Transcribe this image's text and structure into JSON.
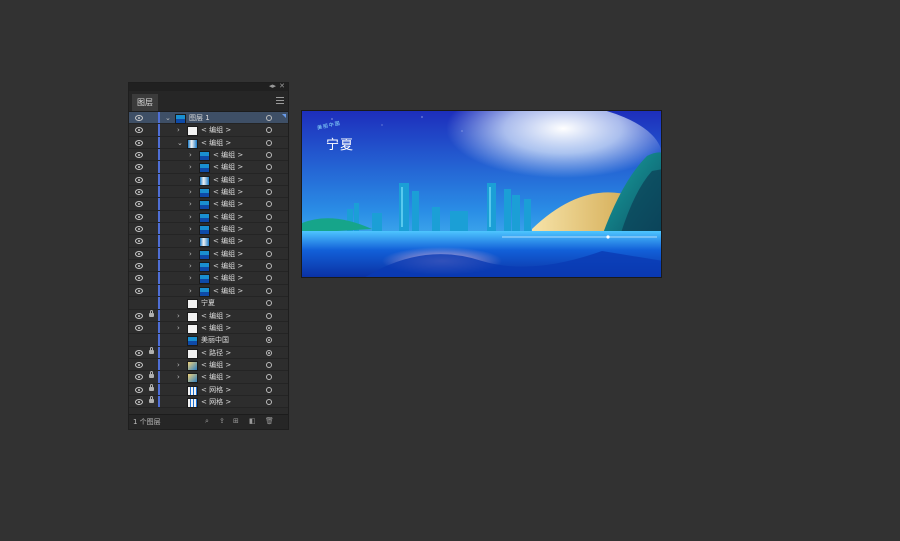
{
  "layers_panel": {
    "tab_label": "图层",
    "collapse_glyph": "◂▸",
    "close_glyph": "✕",
    "footer_count": "1 个图层",
    "rows": [
      {
        "label": "图层 1",
        "indent": 0,
        "arrow": "⌄",
        "thumb": "city",
        "eye": true,
        "lock": false,
        "target": "circle",
        "selected": true
      },
      {
        "label": "< 编组 >",
        "indent": 1,
        "arrow": "›",
        "thumb": "white",
        "eye": true,
        "lock": false,
        "target": "circle",
        "selected": false
      },
      {
        "label": "< 编组 >",
        "indent": 1,
        "arrow": "⌄",
        "thumb": "dark",
        "eye": true,
        "lock": false,
        "target": "circle",
        "selected": false
      },
      {
        "label": "< 编组 >",
        "indent": 2,
        "arrow": "›",
        "thumb": "city",
        "eye": true,
        "lock": false,
        "target": "circle",
        "selected": false
      },
      {
        "label": "< 编组 >",
        "indent": 2,
        "arrow": "›",
        "thumb": "city",
        "eye": true,
        "lock": false,
        "target": "circle",
        "selected": false
      },
      {
        "label": "< 编组 >",
        "indent": 2,
        "arrow": "›",
        "thumb": "dark",
        "eye": true,
        "lock": false,
        "target": "circle",
        "selected": false
      },
      {
        "label": "< 编组 >",
        "indent": 2,
        "arrow": "›",
        "thumb": "city",
        "eye": true,
        "lock": false,
        "target": "circle",
        "selected": false
      },
      {
        "label": "< 编组 >",
        "indent": 2,
        "arrow": "›",
        "thumb": "city",
        "eye": true,
        "lock": false,
        "target": "circle",
        "selected": false
      },
      {
        "label": "< 编组 >",
        "indent": 2,
        "arrow": "›",
        "thumb": "city",
        "eye": true,
        "lock": false,
        "target": "circle",
        "selected": false
      },
      {
        "label": "< 编组 >",
        "indent": 2,
        "arrow": "›",
        "thumb": "city",
        "eye": true,
        "lock": false,
        "target": "circle",
        "selected": false
      },
      {
        "label": "< 编组 >",
        "indent": 2,
        "arrow": "›",
        "thumb": "dark",
        "eye": true,
        "lock": false,
        "target": "circle",
        "selected": false
      },
      {
        "label": "< 编组 >",
        "indent": 2,
        "arrow": "›",
        "thumb": "city",
        "eye": true,
        "lock": false,
        "target": "circle",
        "selected": false
      },
      {
        "label": "< 编组 >",
        "indent": 2,
        "arrow": "›",
        "thumb": "city",
        "eye": true,
        "lock": false,
        "target": "circle",
        "selected": false
      },
      {
        "label": "< 编组 >",
        "indent": 2,
        "arrow": "›",
        "thumb": "city",
        "eye": true,
        "lock": false,
        "target": "circle",
        "selected": false
      },
      {
        "label": "< 编组 >",
        "indent": 2,
        "arrow": "›",
        "thumb": "city",
        "eye": true,
        "lock": false,
        "target": "circle",
        "selected": false
      },
      {
        "label": "宁夏",
        "indent": 1,
        "arrow": "",
        "thumb": "white",
        "eye": false,
        "lock": false,
        "target": "circle",
        "selected": false
      },
      {
        "label": "< 编组 >",
        "indent": 1,
        "arrow": "›",
        "thumb": "white",
        "eye": true,
        "lock": true,
        "target": "circle",
        "selected": false
      },
      {
        "label": "< 编组 >",
        "indent": 1,
        "arrow": "›",
        "thumb": "white",
        "eye": true,
        "lock": false,
        "target": "filled",
        "selected": false
      },
      {
        "label": "美丽中国",
        "indent": 1,
        "arrow": "",
        "thumb": "city",
        "eye": false,
        "lock": false,
        "target": "filled",
        "selected": false
      },
      {
        "label": "< 路径 >",
        "indent": 1,
        "arrow": "",
        "thumb": "white",
        "eye": true,
        "lock": true,
        "target": "filled",
        "selected": false
      },
      {
        "label": "< 编组 >",
        "indent": 1,
        "arrow": "›",
        "thumb": "gold",
        "eye": true,
        "lock": false,
        "target": "circle",
        "selected": false
      },
      {
        "label": "< 编组 >",
        "indent": 1,
        "arrow": "›",
        "thumb": "gold",
        "eye": true,
        "lock": true,
        "target": "circle",
        "selected": false
      },
      {
        "label": "< 网格 >",
        "indent": 1,
        "arrow": "",
        "thumb": "grid",
        "eye": true,
        "lock": true,
        "target": "circle",
        "selected": false
      },
      {
        "label": "< 网格 >",
        "indent": 1,
        "arrow": "",
        "thumb": "grid",
        "eye": true,
        "lock": true,
        "target": "circle",
        "selected": false
      }
    ],
    "footer_icons": [
      "search-icon",
      "export-icon",
      "new-sublayer-icon",
      "new-layer-icon",
      "delete-icon"
    ]
  },
  "artboard": {
    "title": "宁夏",
    "subtitle": "美丽中国",
    "colors": {
      "sky_top": "#1a2fb8",
      "sky_glow": "#e8f4ff",
      "water": "#0b5fd6",
      "mountain": "#0e6a7a",
      "sand": "#e8c46a",
      "pink": "#f4b6d8"
    }
  }
}
